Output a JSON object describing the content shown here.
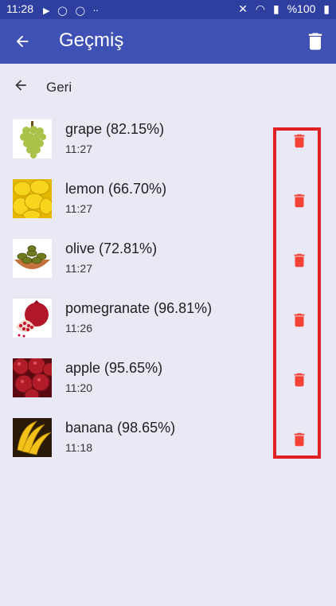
{
  "status_bar": {
    "time": "11:28",
    "battery": "%100",
    "icons": [
      "youtube-icon",
      "o-icon",
      "o-icon",
      "dots-icon",
      "mute-icon",
      "wifi-icon",
      "signal-icon",
      "battery-icon"
    ]
  },
  "app_bar": {
    "title": "Geçmiş",
    "color": "#3f51b5",
    "back_icon": "arrow-left-icon",
    "action_icon": "trash-icon"
  },
  "back_link": {
    "label": "Geri"
  },
  "history": [
    {
      "label": "grape (82.15%)",
      "time": "11:27",
      "image": "grape-image"
    },
    {
      "label": "lemon (66.70%)",
      "time": "11:27",
      "image": "lemon-image"
    },
    {
      "label": "olive (72.81%)",
      "time": "11:27",
      "image": "olive-image"
    },
    {
      "label": "pomegranate (96.81%)",
      "time": "11:26",
      "image": "pomegranate-image"
    },
    {
      "label": "apple (95.65%)",
      "time": "11:20",
      "image": "apple-image"
    },
    {
      "label": "banana (98.65%)",
      "time": "11:18",
      "image": "banana-image"
    }
  ],
  "delete_color": "#f44336",
  "highlight_color": "#e02020"
}
